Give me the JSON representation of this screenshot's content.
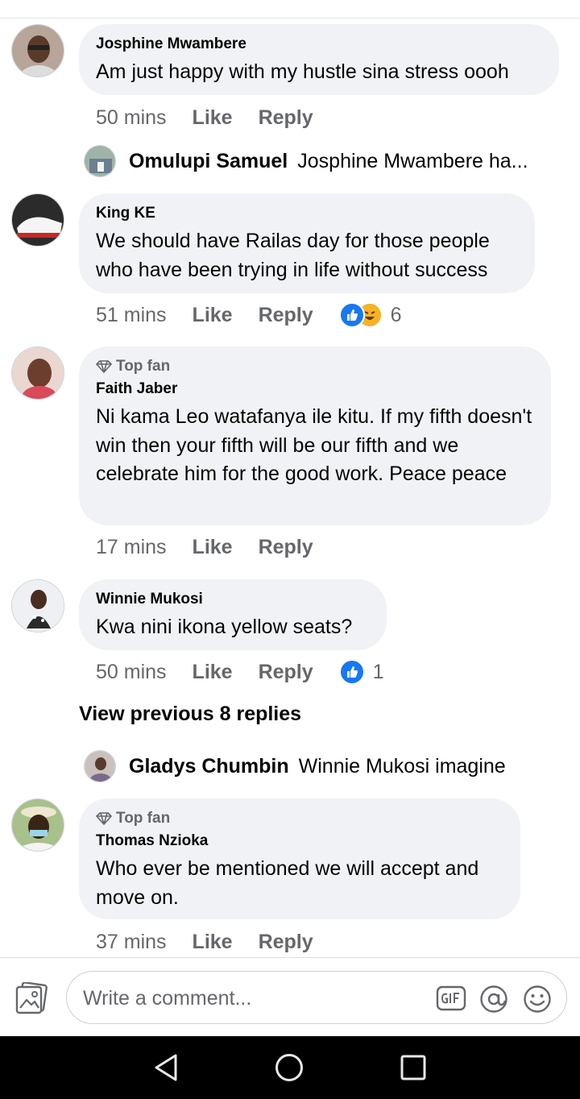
{
  "comments": [
    {
      "author": "Josphine Mwambere",
      "text": "Am just happy with my hustle sina stress oooh",
      "time": "50 mins",
      "like": "Like",
      "reply": "Reply"
    },
    {
      "author": "King KE",
      "text": "We should have Railas day for those people who have been trying in life without success",
      "time": "51 mins",
      "like": "Like",
      "reply": "Reply",
      "reactions": {
        "icons": [
          "like-reaction-icon",
          "haha-reaction-icon"
        ],
        "count": "6"
      }
    },
    {
      "badge": "Top fan",
      "author": "Faith Jaber",
      "text": "Ni kama Leo watafanya ile kitu. If my fifth doesn't win then your fifth will be our fifth and we celebrate him for the good work. Peace peace",
      "time": "17 mins",
      "like": "Like",
      "reply": "Reply"
    },
    {
      "author": "Winnie Mukosi",
      "text": "Kwa nini ikona yellow seats?",
      "time": "50 mins",
      "like": "Like",
      "reply": "Reply",
      "reactions": {
        "icons": [
          "like-reaction-icon"
        ],
        "count": "1"
      }
    },
    {
      "badge": "Top fan",
      "author": "Thomas Nzioka",
      "text": "Who ever be mentioned we will accept and move on.",
      "time": "37 mins",
      "like": "Like",
      "reply": "Reply"
    }
  ],
  "replies": [
    {
      "author": "Omulupi Samuel",
      "text": "Josphine Mwambere ha..."
    },
    {
      "author": "Gladys Chumbin",
      "text": "Winnie Mukosi imagine"
    }
  ],
  "view_previous": "View previous 8 replies",
  "composer": {
    "placeholder": "Write a comment...",
    "icons": [
      "photo-icon",
      "gif-icon",
      "mention-icon",
      "emoji-icon"
    ]
  },
  "nav": {
    "icons": [
      "back-icon",
      "home-icon",
      "recents-icon"
    ]
  },
  "colors": {
    "accent": "#1877f2",
    "bubble": "#f0f2f5",
    "muted": "#65676b",
    "haha": "#f7b125"
  }
}
